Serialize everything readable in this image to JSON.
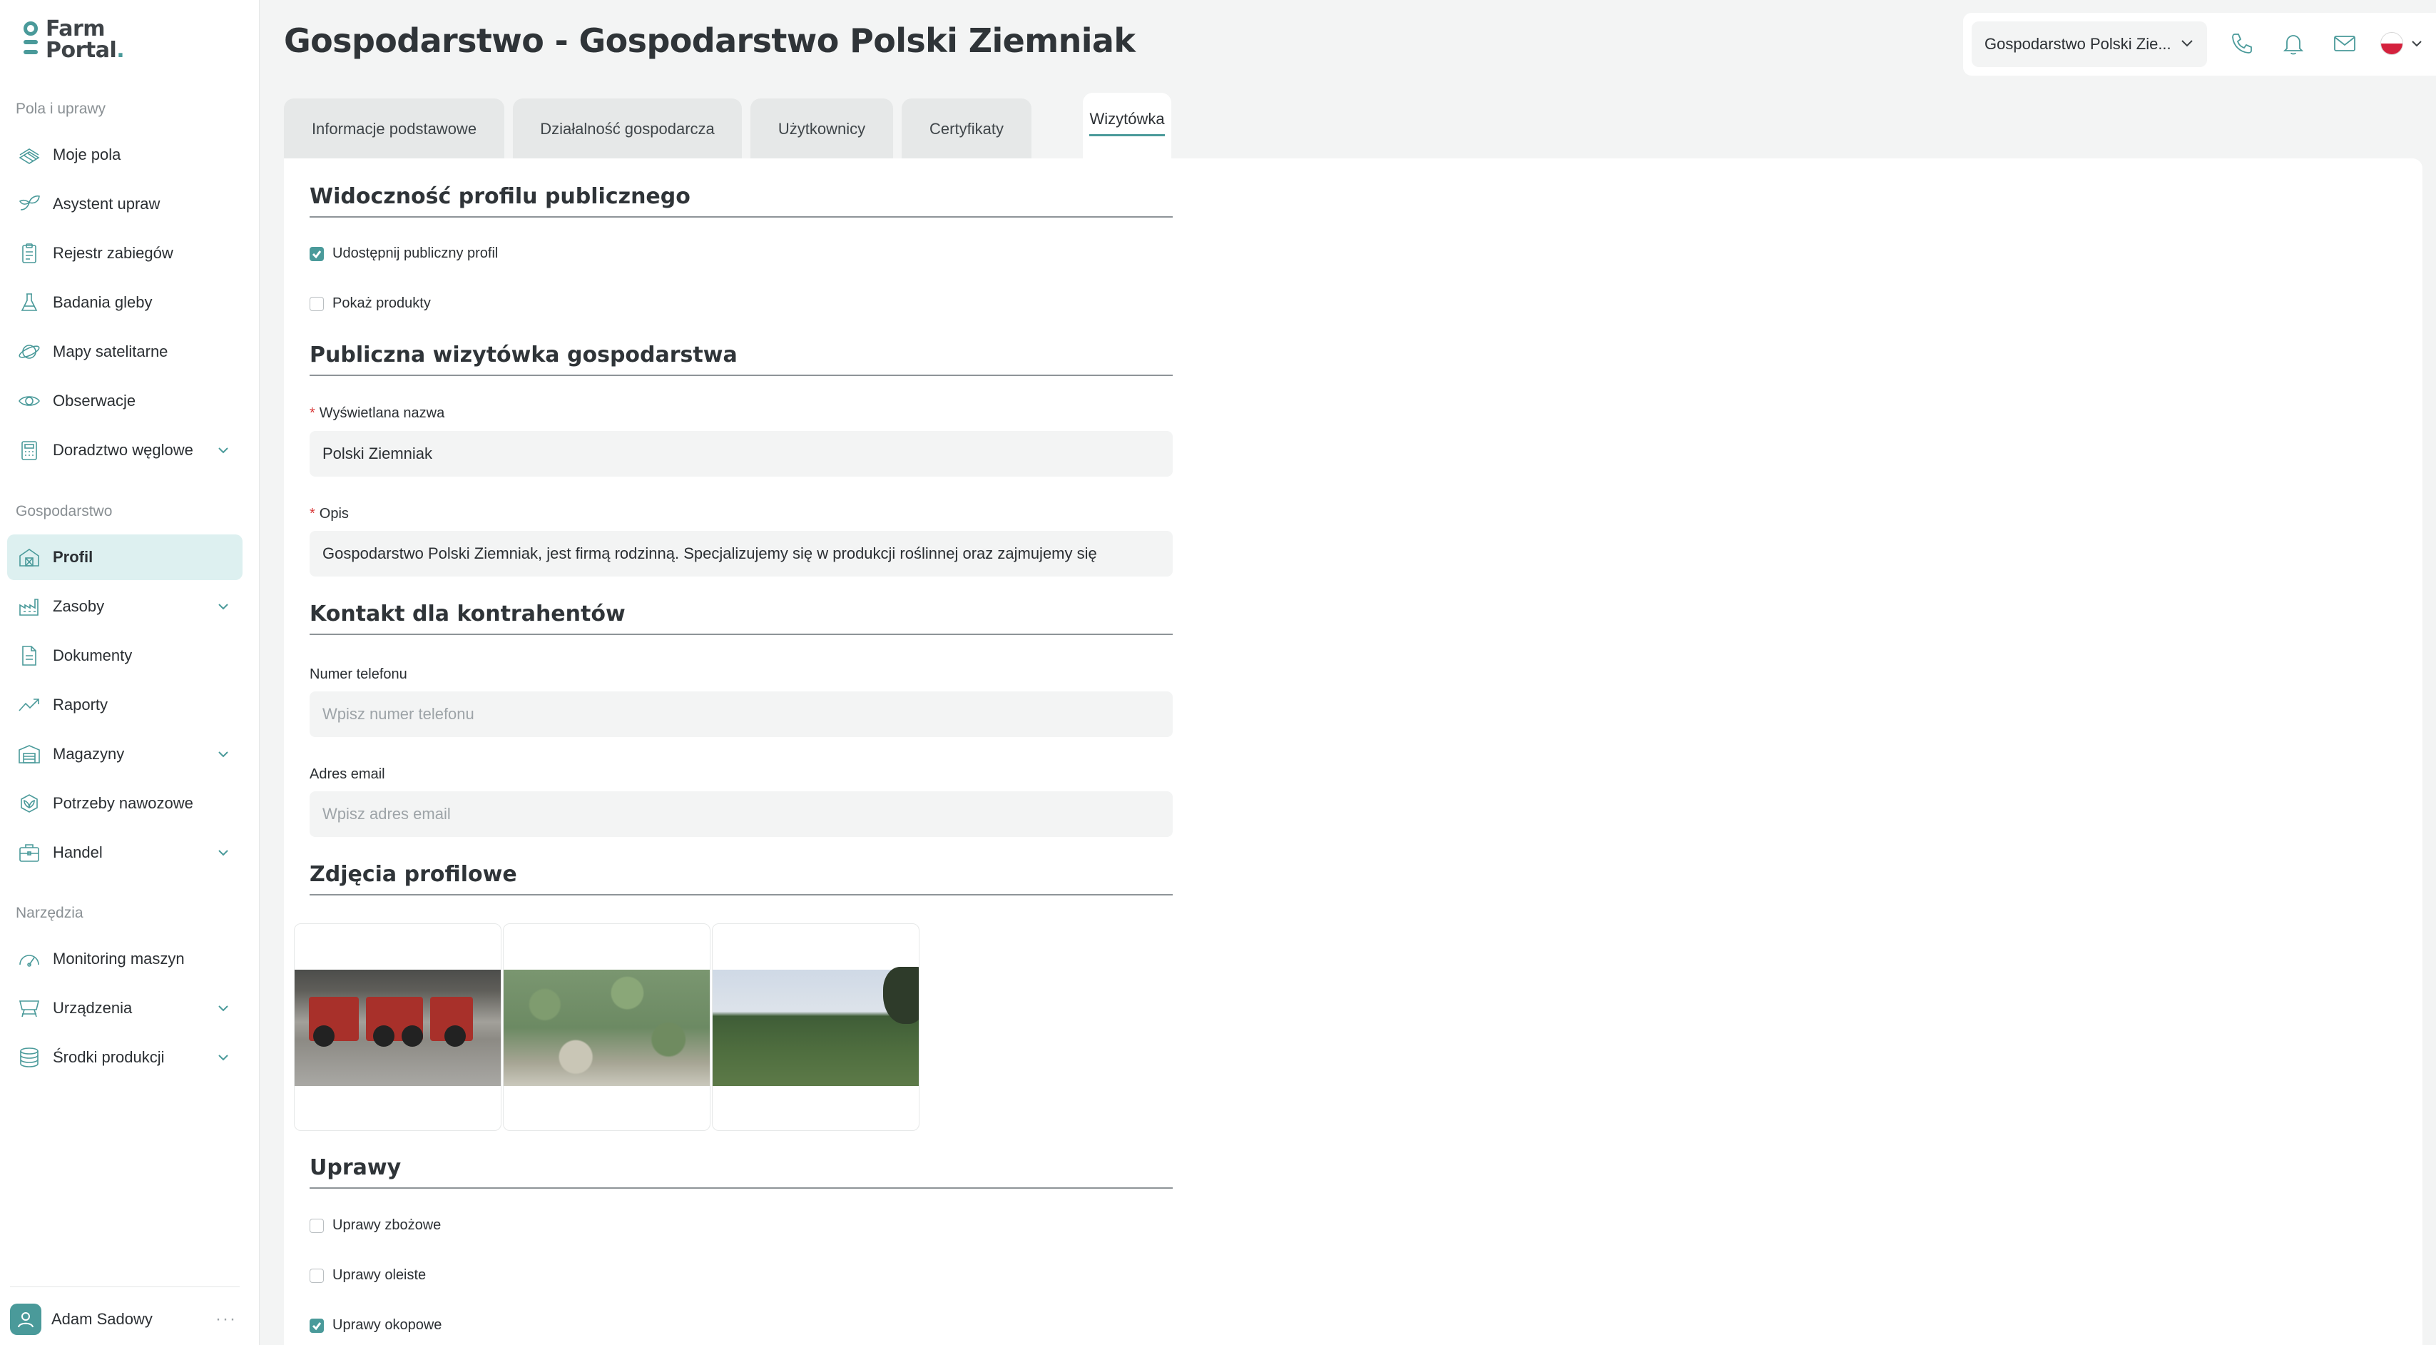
{
  "app": {
    "logo_line1": "Farm",
    "logo_line2": "Portal",
    "logo_dot": "."
  },
  "sidebar": {
    "sections": [
      {
        "title": "Pola i uprawy",
        "items": [
          {
            "label": "Moje pola",
            "icon": "fields-icon"
          },
          {
            "label": "Asystent upraw",
            "icon": "sprout-icon"
          },
          {
            "label": "Rejestr zabiegów",
            "icon": "clipboard-icon"
          },
          {
            "label": "Badania gleby",
            "icon": "flask-icon"
          },
          {
            "label": "Mapy satelitarne",
            "icon": "planet-icon"
          },
          {
            "label": "Obserwacje",
            "icon": "eye-icon"
          },
          {
            "label": "Doradztwo węglowe",
            "icon": "calculator-icon",
            "expandable": true
          }
        ]
      },
      {
        "title": "Gospodarstwo",
        "items": [
          {
            "label": "Profil",
            "icon": "barn-icon",
            "active": true
          },
          {
            "label": "Zasoby",
            "icon": "factory-icon",
            "expandable": true
          },
          {
            "label": "Dokumenty",
            "icon": "document-icon"
          },
          {
            "label": "Raporty",
            "icon": "trend-icon"
          },
          {
            "label": "Magazyny",
            "icon": "warehouse-icon",
            "expandable": true
          },
          {
            "label": "Potrzeby nawozowe",
            "icon": "leaf-box-icon"
          },
          {
            "label": "Handel",
            "icon": "briefcase-icon",
            "expandable": true
          }
        ]
      },
      {
        "title": "Narzędzia",
        "items": [
          {
            "label": "Monitoring maszyn",
            "icon": "gauge-icon"
          },
          {
            "label": "Urządzenia",
            "icon": "device-icon",
            "expandable": true
          },
          {
            "label": "Środki produkcji",
            "icon": "stack-icon",
            "expandable": true
          }
        ]
      }
    ],
    "user": {
      "name": "Adam Sadowy",
      "more": "···"
    }
  },
  "header": {
    "title": "Gospodarstwo - Gospodarstwo Polski Ziemniak",
    "farm_select": "Gospodarstwo Polski Zie...",
    "language": "pl"
  },
  "tabs": [
    {
      "label": "Informacje podstawowe"
    },
    {
      "label": "Działalność gospodarcza"
    },
    {
      "label": "Użytkownicy"
    },
    {
      "label": "Certyfikaty"
    },
    {
      "label": "Wizytówka",
      "active": true
    }
  ],
  "panel": {
    "visibility": {
      "title": "Widoczność profilu publicznego",
      "share_profile": {
        "label": "Udostępnij publiczny profil",
        "checked": true
      },
      "show_products": {
        "label": "Pokaż produkty",
        "checked": false
      }
    },
    "card": {
      "title": "Publiczna wizytówka gospodarstwa",
      "display_name_label": "Wyświetlana nazwa",
      "display_name_value": "Polski Ziemniak",
      "description_label": "Opis",
      "description_value": "Gospodarstwo Polski Ziemniak, jest firmą rodzinną. Specjalizujemy się w produkcji roślinnej oraz zajmujemy się",
      "required_mark": "*"
    },
    "contact": {
      "title": "Kontakt dla kontrahentów",
      "phone_label": "Numer telefonu",
      "phone_placeholder": "Wpisz numer telefonu",
      "email_label": "Adres email",
      "email_placeholder": "Wpisz adres email"
    },
    "photos": {
      "title": "Zdjęcia profilowe",
      "items": [
        "machinery-shed-photo",
        "potato-plants-photo",
        "field-landscape-photo"
      ]
    },
    "crops": {
      "title": "Uprawy",
      "items": [
        {
          "label": "Uprawy zbożowe",
          "checked": false
        },
        {
          "label": "Uprawy oleiste",
          "checked": false
        },
        {
          "label": "Uprawy okopowe",
          "checked": true
        }
      ]
    }
  },
  "colors": {
    "accent": "#4a9a9a",
    "active_nav_bg": "#ddf0f0",
    "page_bg": "#f3f4f4",
    "required": "#d83a3a"
  }
}
